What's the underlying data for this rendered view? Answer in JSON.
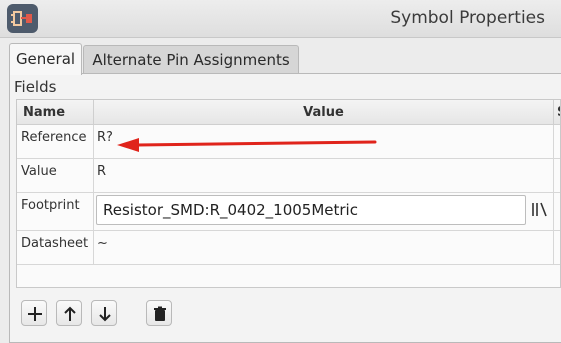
{
  "window": {
    "title": "Symbol Properties"
  },
  "tabs": [
    {
      "label": "General",
      "active": true
    },
    {
      "label": "Alternate Pin Assignments",
      "active": false
    }
  ],
  "fields": {
    "group_label": "Fields",
    "columns": {
      "name": "Name",
      "value": "Value",
      "extra": "S"
    },
    "rows": [
      {
        "name": "Reference",
        "value": "R?"
      },
      {
        "name": "Value",
        "value": "R"
      },
      {
        "name": "Footprint",
        "value": "Resistor_SMD:R_0402_1005Metric"
      },
      {
        "name": "Datasheet",
        "value": "~"
      }
    ]
  },
  "annotation": {
    "arrow_color": "#e0241b"
  },
  "toolbar": {
    "buttons": [
      "add-icon",
      "move-up-icon",
      "move-down-icon",
      "delete-icon"
    ]
  }
}
